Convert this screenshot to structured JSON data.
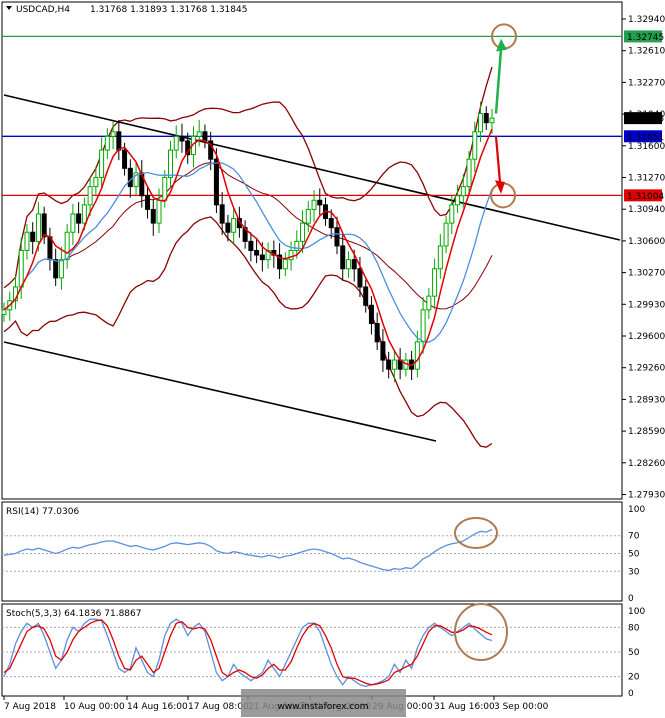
{
  "header": {
    "symbol": "USDCAD,H4",
    "ohlc": "1.31768 1.31893 1.31768 1.31845"
  },
  "price_axis": {
    "ticks": [
      "1.32940",
      "1.32610",
      "1.32270",
      "1.31940",
      "1.31600",
      "1.31270",
      "1.30940",
      "1.30600",
      "1.30270",
      "1.29930",
      "1.29600",
      "1.29260",
      "1.28930",
      "1.28590",
      "1.28260",
      "1.27930"
    ],
    "current_price_label": "1.31845"
  },
  "levels": [
    {
      "name": "resistance-green",
      "value": 1.32745,
      "label": "1.32745",
      "color": "#22a050"
    },
    {
      "name": "level-blue",
      "value": 1.31651,
      "label": "1.31651",
      "color": "#0000cc"
    },
    {
      "name": "support-red",
      "value": 1.31004,
      "label": "1.31004",
      "color": "#e00000"
    }
  ],
  "rsi": {
    "title": "RSI(14) 77.0306",
    "axis_labels": [
      "100",
      "70",
      "50",
      "30",
      "0"
    ],
    "color": "#5c8fe0"
  },
  "stoch": {
    "title": "Stoch(5,3,3) 64.1836 71.8867",
    "axis_labels": [
      "100",
      "80",
      "50",
      "20",
      "0"
    ],
    "main_color": "#5c8fe0",
    "signal_color": "#e00000"
  },
  "time_axis": {
    "labels": [
      "7 Aug 2018",
      "10 Aug 00:00",
      "14 Aug 16:00",
      "17 Aug 08:00",
      "21 Aug 16:00",
      "24 Aug 08:00",
      "29 Aug 00:00",
      "31 Aug 16:00",
      "3 Sep 00:00"
    ]
  },
  "watermark": "www.instaforex.com",
  "colors": {
    "bull_candle": "#00aa00",
    "bear_candle": "#000000",
    "ma_fast": "#e00000",
    "ma_slow": "#4a8fe0",
    "bollinger": "#8b0000",
    "channel": "#000000",
    "annotation": "#b07a50",
    "arrow_up": "#22b04a",
    "arrow_down": "#e00000"
  },
  "chart_data": {
    "type": "candlestick",
    "y_range": [
      1.277,
      1.331
    ],
    "closes": [
      1.2975,
      1.2985,
      1.3,
      1.304,
      1.306,
      1.305,
      1.308,
      1.3055,
      1.303,
      1.301,
      1.303,
      1.306,
      1.308,
      1.307,
      1.309,
      1.311,
      1.312,
      1.315,
      1.3165,
      1.317,
      1.315,
      1.313,
      1.311,
      1.3125,
      1.31,
      1.3085,
      1.307,
      1.3095,
      1.312,
      1.315,
      1.3165,
      1.316,
      1.3145,
      1.3165,
      1.317,
      1.316,
      1.314,
      1.309,
      1.307,
      1.306,
      1.3075,
      1.3065,
      1.305,
      1.304,
      1.3035,
      1.303,
      1.304,
      1.3035,
      1.302,
      1.303,
      1.304,
      1.305,
      1.307,
      1.3085,
      1.3095,
      1.309,
      1.3075,
      1.3065,
      1.3045,
      1.302,
      1.303,
      1.302,
      1.3,
      1.298,
      1.296,
      1.294,
      1.292,
      1.291,
      1.292,
      1.291,
      1.292,
      1.291,
      1.294,
      1.2975,
      1.299,
      1.302,
      1.3045,
      1.307,
      1.309,
      1.31,
      1.311,
      1.314,
      1.317,
      1.319,
      1.318,
      1.3185
    ],
    "rsi_values": [
      48,
      49,
      50,
      53,
      55,
      54,
      56,
      54,
      52,
      50,
      52,
      55,
      57,
      56,
      58,
      60,
      61,
      63,
      64,
      64,
      62,
      60,
      58,
      59,
      57,
      55,
      54,
      56,
      58,
      61,
      62,
      61,
      60,
      61,
      62,
      61,
      58,
      53,
      51,
      50,
      52,
      51,
      49,
      48,
      47,
      46,
      48,
      47,
      45,
      47,
      48,
      50,
      52,
      54,
      55,
      54,
      52,
      50,
      47,
      44,
      45,
      43,
      40,
      38,
      36,
      34,
      32,
      31,
      33,
      32,
      34,
      33,
      38,
      44,
      47,
      52,
      56,
      59,
      61,
      62,
      64,
      68,
      72,
      75,
      74,
      77
    ],
    "stoch_main": [
      20,
      35,
      60,
      75,
      85,
      80,
      85,
      70,
      50,
      30,
      40,
      65,
      80,
      75,
      85,
      90,
      90,
      88,
      70,
      50,
      30,
      25,
      30,
      55,
      40,
      25,
      20,
      40,
      70,
      85,
      90,
      85,
      70,
      80,
      85,
      75,
      50,
      25,
      15,
      20,
      35,
      25,
      20,
      15,
      20,
      25,
      40,
      30,
      20,
      35,
      50,
      65,
      80,
      85,
      85,
      75,
      55,
      35,
      20,
      10,
      20,
      15,
      10,
      8,
      10,
      12,
      15,
      20,
      35,
      25,
      40,
      30,
      55,
      70,
      80,
      85,
      80,
      75,
      70,
      75,
      80,
      85,
      78,
      72,
      66,
      64
    ],
    "stoch_signal": [
      25,
      30,
      45,
      60,
      75,
      80,
      82,
      78,
      65,
      45,
      40,
      50,
      65,
      75,
      80,
      85,
      88,
      89,
      82,
      65,
      45,
      30,
      28,
      40,
      45,
      35,
      25,
      30,
      50,
      70,
      85,
      87,
      80,
      78,
      80,
      78,
      65,
      45,
      25,
      20,
      25,
      28,
      25,
      20,
      18,
      22,
      30,
      35,
      28,
      28,
      38,
      55,
      70,
      80,
      85,
      82,
      70,
      55,
      35,
      20,
      18,
      18,
      15,
      12,
      10,
      11,
      13,
      16,
      25,
      28,
      32,
      35,
      45,
      60,
      75,
      82,
      82,
      78,
      74,
      74,
      77,
      82,
      81,
      78,
      74,
      71
    ]
  }
}
